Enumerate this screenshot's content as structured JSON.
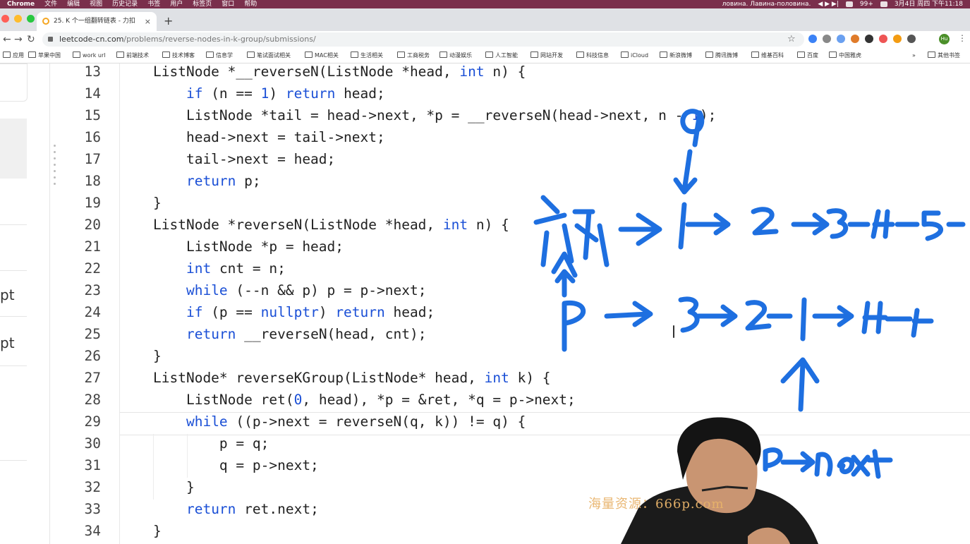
{
  "menubar": {
    "app": "Chrome",
    "items": [
      "文件",
      "编辑",
      "视图",
      "历史记录",
      "书签",
      "用户",
      "标签页",
      "窗口",
      "帮助"
    ],
    "right_text": "ловина. Лавина-половина.",
    "battery": "99+",
    "datetime": "3月4日 周四 下午11:18"
  },
  "tab": {
    "title": "25. K 个一组翻转链表 - 力扣（L",
    "close": "×",
    "new_tab": "+"
  },
  "address": {
    "domain": "leetcode-cn.com",
    "path": "/problems/reverse-nodes-in-k-group/submissions/",
    "profile": "Hu"
  },
  "bookmarks": [
    {
      "label": "应用"
    },
    {
      "label": "苹果中国"
    },
    {
      "label": "work url"
    },
    {
      "label": "前端技术"
    },
    {
      "label": "技术博客"
    },
    {
      "label": "信息学"
    },
    {
      "label": "笔试面试相关"
    },
    {
      "label": "MAC相关"
    },
    {
      "label": "生活相关"
    },
    {
      "label": "工商税务"
    },
    {
      "label": "动漫娱乐"
    },
    {
      "label": "人工智能"
    },
    {
      "label": "网站开发"
    },
    {
      "label": "科技信息"
    },
    {
      "label": "iCloud"
    },
    {
      "label": "新浪微博"
    },
    {
      "label": "腾讯微博"
    },
    {
      "label": "维基百科"
    },
    {
      "label": "百度"
    },
    {
      "label": "中国雅虎"
    },
    {
      "label": "»"
    },
    {
      "label": "其他书签"
    }
  ],
  "left_panel": {
    "text_a": "pt",
    "text_b": "pt"
  },
  "code": [
    {
      "n": "13",
      "src": "ListNode *__reverseN(ListNode *head, int n) {"
    },
    {
      "n": "14",
      "src": "    if (n == 1) return head;"
    },
    {
      "n": "15",
      "src": "    ListNode *tail = head->next, *p = __reverseN(head->next, n - 1);"
    },
    {
      "n": "16",
      "src": "    head->next = tail->next;"
    },
    {
      "n": "17",
      "src": "    tail->next = head;"
    },
    {
      "n": "18",
      "src": "    return p;"
    },
    {
      "n": "19",
      "src": "}"
    },
    {
      "n": "20",
      "src": "ListNode *reverseN(ListNode *head, int n) {"
    },
    {
      "n": "21",
      "src": "    ListNode *p = head;"
    },
    {
      "n": "22",
      "src": "    int cnt = n;"
    },
    {
      "n": "23",
      "src": "    while (--n && p) p = p->next;"
    },
    {
      "n": "24",
      "src": "    if (p == nullptr) return head;"
    },
    {
      "n": "25",
      "src": "    return __reverseN(head, cnt);"
    },
    {
      "n": "26",
      "src": "}"
    },
    {
      "n": "27",
      "src": "ListNode* reverseKGroup(ListNode* head, int k) {"
    },
    {
      "n": "28",
      "src": "    ListNode ret(0, head), *p = &ret, *q = p->next;"
    },
    {
      "n": "29",
      "src": "    while ((p->next = reverseN(q, k)) != q) {"
    },
    {
      "n": "30",
      "src": "        p = q;"
    },
    {
      "n": "31",
      "src": "        q = p->next;"
    },
    {
      "n": "32",
      "src": "    }"
    },
    {
      "n": "33",
      "src": "    return ret.next;"
    },
    {
      "n": "34",
      "src": "}"
    }
  ],
  "ink": {
    "label_q": "q",
    "head_label": "虚头",
    "row1": "1 → 2 → 3 → 4 → 5",
    "row2_start": "P",
    "row2": "3 → 2 → 1 → 4 → 5",
    "pnext": "P→next"
  },
  "watermark": "海量资源：666p.com",
  "colors": {
    "ink": "#1e6fe0",
    "keyword": "#1a4fd6",
    "menubar": "#7a2f4c",
    "watermark": "#e8b36a"
  }
}
